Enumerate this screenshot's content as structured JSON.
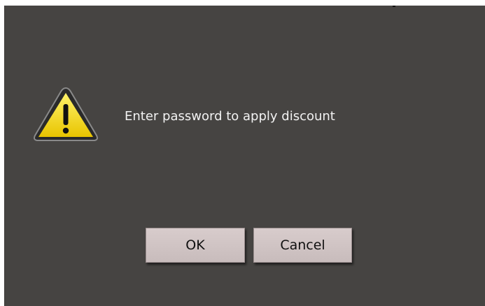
{
  "dialog": {
    "message": "Enter password to apply discount",
    "icon": "warning-icon",
    "buttons": {
      "ok_label": "OK",
      "cancel_label": "Cancel"
    }
  },
  "colors": {
    "background": "#464442",
    "button": "#d0c4c4",
    "warning_yellow": "#f5d000",
    "text": "#f2f2f2"
  }
}
